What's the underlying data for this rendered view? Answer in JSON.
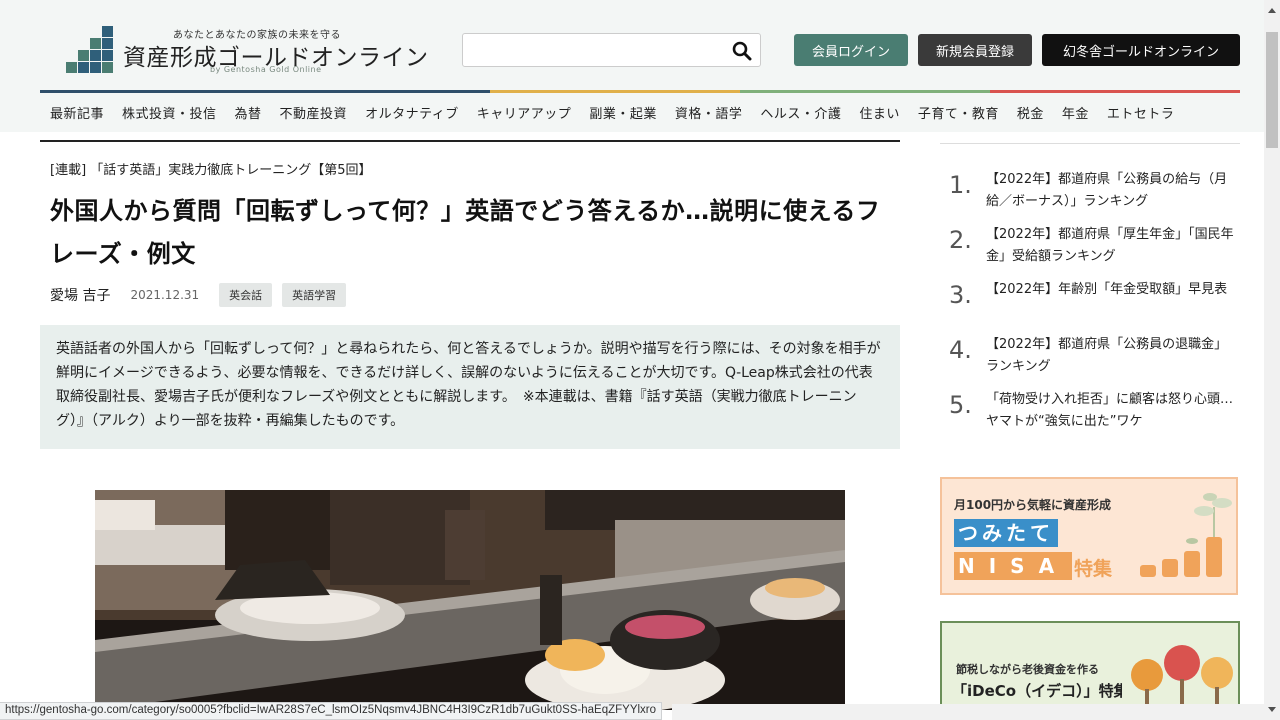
{
  "header": {
    "logo_tagline": "あなたとあなたの家族の未来を守る",
    "logo_title": "資産形成ゴールドオンライン",
    "logo_subtitle": "by Gentosha Gold Online",
    "search_placeholder": "",
    "search_icon": "search-icon",
    "login_label": "会員ログイン",
    "register_label": "新規会員登録",
    "gold_label": "幻冬舎ゴールドオンライン",
    "colors": {
      "login": "#4a7d72",
      "register": "#3a3a3a",
      "gold": "#111111"
    }
  },
  "nav": {
    "items": [
      "最新記事",
      "株式投資・投信",
      "為替",
      "不動産投資",
      "オルタナティブ",
      "キャリアアップ",
      "副業・起業",
      "資格・語学",
      "ヘルス・介護",
      "住まい",
      "子育て・教育",
      "税金",
      "年金",
      "エトセトラ"
    ]
  },
  "article": {
    "series": "[連載] 「話す英語」実践力徹底トレーニング【第5回】",
    "title": "外国人から質問「回転ずしって何？」英語でどう答えるか…説明に使えるフレーズ・例文",
    "author": "愛場 吉子",
    "date": "2021.12.31",
    "tags": [
      "英会話",
      "英語学習"
    ],
    "lead": "英語話者の外国人から「回転ずしって何？」と尋ねられたら、何と答えるでしょうか。説明や描写を行う際には、その対象を相手が鮮明にイメージできるよう、必要な情報を、できるだけ詳しく、誤解のないように伝えることが大切です。Q‐Leap株式会社の代表取締役副社長、愛場吉子氏が便利なフレーズや例文とともに解説します。　※本連載は、書籍『話す英語（実戦力徹底トレーニング）』（アルク）より一部を抜粋・再編集したものです。"
  },
  "ranking": [
    {
      "num": "1.",
      "text": "【2022年】都道府県「公務員の給与（月給／ボーナス）」ランキング"
    },
    {
      "num": "2.",
      "text": "【2022年】都道府県「厚生年金」「国民年金」受給額ランキング"
    },
    {
      "num": "3.",
      "text": "【2022年】年齢別「年金受取額」早見表"
    },
    {
      "num": "4.",
      "text": "【2022年】都道府県「公務員の退職金」ランキング"
    },
    {
      "num": "5.",
      "text": "「荷物受け入れ拒否」に顧客は怒り心頭…ヤマトが“強気に出た”ワケ"
    }
  ],
  "banners": {
    "nisa_caption": "月100円から気軽に資産形成",
    "nisa_line1": "つみたて",
    "nisa_line2": "NISA",
    "nisa_suffix": "特集",
    "ideco_caption": "節税しながら老後資金を作る",
    "ideco_title": "「iDeCo（イデコ）」特集"
  },
  "statusbar": {
    "url": "https://gentosha-go.com/category/so0005?fbclid=IwAR28S7eC_lsmOIz5Nqsmv4JBNC4H3I9CzR1db7uGukt0SS-haEqZFYYlxro"
  }
}
